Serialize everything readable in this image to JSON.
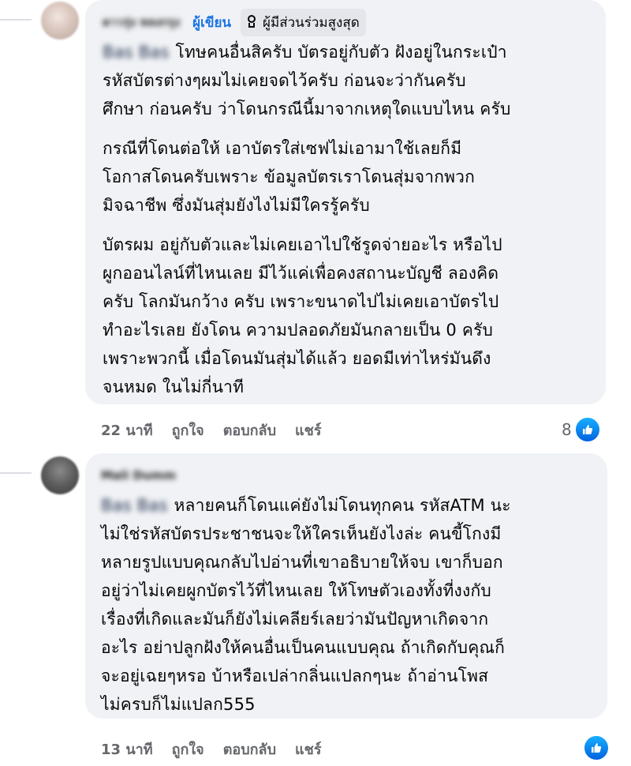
{
  "comments": [
    {
      "author": "ดาวรุ่ง หลงกรุง",
      "author_badge": "ผู้เขียน",
      "top_fan_badge": "ผู้มีส่วนร่วมสูงสุด",
      "mention": "Bas Bas",
      "paragraphs": [
        {
          "lines": [
            "โทษคนอื่นสิครับ บัตรอยู่กับตัว ฝังอยู่ในกระเป๋า",
            "รหัสบัตรต่างๆผมไม่เคยจดไว้ครับ ก่อนจะว่ากันครับ",
            "ศึกษา ก่อนครับ ว่าโดนกรณีนี้มาจากเหตุใดแบบไหน ครับ"
          ]
        },
        {
          "lines": [
            "กรณีที่โดนต่อให้ เอาบัตรใส่เซฟไม่เอามาใช้เลยก็มี",
            "โอกาสโดนครับเพราะ ข้อมูลบัตรเราโดนสุ่มจากพวก",
            "มิจฉาชีพ ซึ่งมันสุ่มยังไงไม่มีใครรู้ครับ"
          ]
        },
        {
          "lines": [
            "บัตรผม อยู่กับตัวและไม่เคยเอาไปใช้รูดจ่ายอะไร หรือไป",
            "ผูกออนไลน์ที่ไหนเลย มีไว้แค่เพื่อคงสถานะบัญชี ลองคิด",
            "ครับ โลกมันกว้าง ครับ เพราะขนาดไปไม่เคยเอาบัตรไป",
            "ทำอะไรเลย ยังโดน ความปลอดภัยมันกลายเป็น 0 ครับ",
            "เพราะพวกนี้ เมื่อโดนมันสุ่มได้แล้ว ยอดมีเท่าไหร่มันดึง",
            "จนหมด ในไม่กี่นาที"
          ]
        }
      ],
      "time": "22 นาที",
      "like_label": "ถูกใจ",
      "reply_label": "ตอบกลับ",
      "share_label": "แชร์",
      "reaction_count": "8"
    },
    {
      "author": "Mali Dumm",
      "mention": "Bas Bas",
      "paragraphs": [
        {
          "lines": [
            "หลายคนก็โดนแค่ยังไม่โดนทุกคน รหัสATM นะ",
            "ไม่ใช่รหัสบัตรประชาชนจะให้ใครเห็นยังไงล่ะ คนขี้โกงมี",
            "หลายรูปแบบคุณกลับไปอ่านที่เขาอธิบายให้จบ เขาก็บอก",
            "อยู่ว่าไม่เคยผูกบัตรไว้ที่ไหนเลย ให้โทษตัวเองทั้งที่งงกับ",
            "เรื่องที่เกิดและมันก็ยังไม่เคลียร์เลยว่ามันปัญหาเกิดจาก",
            "อะไร อย่าปลูกฝังให้คนอื่นเป็นคนแบบคุณ ถ้าเกิดกับคุณก็",
            "จะอยู่เฉยๆหรอ บ้าหรือเปล่ากลิ่นแปลกๆนะ ถ้าอ่านโพส",
            "ไม่ครบก็ไม่แปลก555"
          ]
        }
      ],
      "time": "13 นาที",
      "like_label": "ถูกใจ",
      "reply_label": "ตอบกลับ",
      "share_label": "แชร์"
    }
  ],
  "icons": {
    "reaction": "like-icon",
    "badge": "medal-icon"
  },
  "colors": {
    "bubble": "#f0f2f5",
    "author_badge": "#1b74e4",
    "meta_text": "#65676b",
    "like_icon": "#1877f2"
  }
}
